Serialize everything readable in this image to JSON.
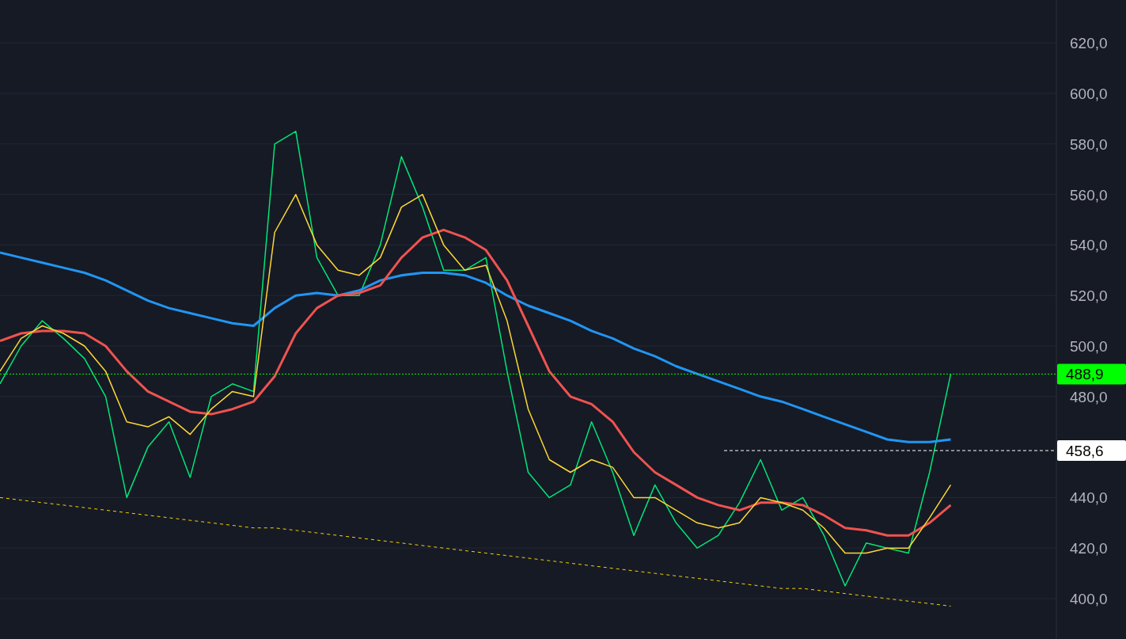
{
  "chart_data": {
    "type": "line",
    "categories": [
      null,
      null,
      null,
      null,
      null,
      null,
      null,
      null,
      null,
      null,
      null,
      null,
      null,
      null,
      null,
      null,
      null,
      null,
      null,
      null,
      null,
      null,
      null,
      null,
      null,
      null,
      null,
      null,
      null,
      null,
      null,
      null,
      null,
      null,
      null,
      null,
      null,
      null,
      null,
      null,
      null,
      null,
      null,
      null,
      null,
      null
    ],
    "ylim": [
      384,
      637
    ],
    "grid": true,
    "yticks": [
      {
        "value": 400,
        "label": "400,0"
      },
      {
        "value": 420,
        "label": "420,0"
      },
      {
        "value": 440,
        "label": "440,0"
      },
      {
        "value": 480,
        "label": "480,0"
      },
      {
        "value": 500,
        "label": "500,0"
      },
      {
        "value": 520,
        "label": "520,0"
      },
      {
        "value": 540,
        "label": "540,0"
      },
      {
        "value": 560,
        "label": "560,0"
      },
      {
        "value": 580,
        "label": "580,0"
      },
      {
        "value": 600,
        "label": "600,0"
      },
      {
        "value": 620,
        "label": "620,0"
      }
    ],
    "series": [
      {
        "color": "#00e676",
        "values": [
          485,
          500,
          510,
          503,
          495,
          480,
          440,
          460,
          470,
          448,
          480,
          485,
          482,
          580,
          585,
          535,
          520,
          520,
          540,
          575,
          555,
          530,
          530,
          535,
          490,
          450,
          440,
          445,
          470,
          450,
          425,
          445,
          430,
          420,
          425,
          438,
          455,
          435,
          440,
          425,
          405,
          422,
          420,
          418,
          450,
          488.9
        ]
      },
      {
        "color": "#2196f3",
        "values": [
          537,
          535,
          533,
          531,
          529,
          526,
          522,
          518,
          515,
          513,
          511,
          509,
          508,
          515,
          520,
          521,
          520,
          522,
          526,
          528,
          529,
          529,
          528,
          525,
          520,
          516,
          513,
          510,
          506,
          503,
          499,
          496,
          492,
          489,
          486,
          483,
          480,
          478,
          475,
          472,
          469,
          466,
          463,
          462,
          462,
          463
        ]
      },
      {
        "color": "#ef5350",
        "values": [
          502,
          505,
          506,
          506,
          505,
          500,
          490,
          482,
          478,
          474,
          473,
          475,
          478,
          488,
          505,
          515,
          520,
          521,
          524,
          535,
          543,
          546,
          543,
          538,
          526,
          508,
          490,
          480,
          477,
          470,
          458,
          450,
          445,
          440,
          437,
          435,
          438,
          438,
          437,
          433,
          428,
          427,
          425,
          425,
          430,
          437
        ]
      },
      {
        "color": "#fdd835",
        "values": [
          490,
          503,
          508,
          505,
          500,
          490,
          470,
          468,
          472,
          465,
          475,
          482,
          480,
          545,
          560,
          540,
          530,
          528,
          535,
          555,
          560,
          540,
          530,
          532,
          510,
          475,
          455,
          450,
          455,
          452,
          440,
          440,
          435,
          430,
          428,
          430,
          440,
          438,
          435,
          428,
          418,
          418,
          420,
          420,
          432,
          445
        ]
      },
      {
        "color": "#f5d300",
        "line_style": "dashed",
        "values": [
          440,
          439,
          438,
          437,
          436,
          435,
          434,
          433,
          432,
          431,
          430,
          429,
          428,
          428,
          427,
          426,
          425,
          424,
          423,
          422,
          421,
          420,
          419,
          418,
          417,
          416,
          415,
          414,
          413,
          412,
          411,
          410,
          409,
          408,
          407,
          406,
          405,
          404,
          404,
          403,
          402,
          401,
          400,
          399,
          398,
          397
        ]
      }
    ],
    "ref_lines": [
      {
        "axis": "y",
        "value": 488.9,
        "label": "488,9",
        "color": "#00ff00"
      },
      {
        "axis": "y",
        "value": 458.6,
        "label": "458,6",
        "color": "#ffffff"
      }
    ]
  }
}
